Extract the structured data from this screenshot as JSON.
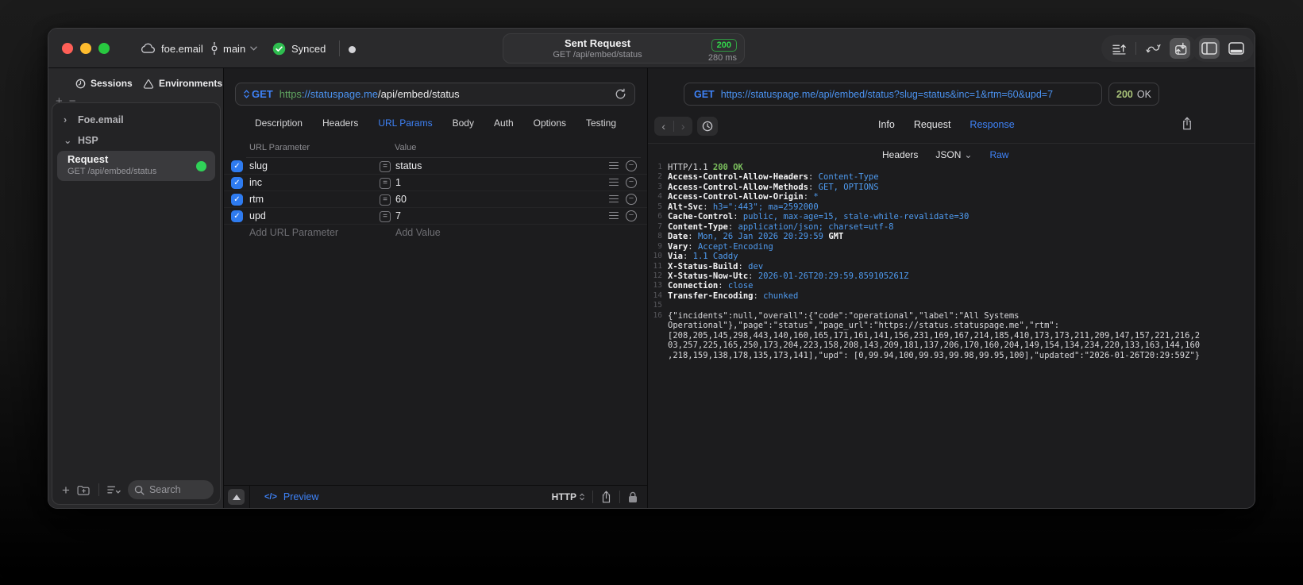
{
  "colors": {
    "accent_blue": "#3e82f7",
    "traffic_red": "#ff5f57",
    "traffic_yellow": "#febc2e",
    "traffic_green": "#28c840",
    "sync_green": "#2ebd4f",
    "badge_green": "#32d74b",
    "status_green": "#a9c379",
    "code_blue": "#4f9bf0",
    "code_green": "#7cc15e",
    "url_scheme_green": "#5fa360"
  },
  "titlebar": {
    "project": "foe.email",
    "branch": "main",
    "sync_status": "Synced",
    "request_summary": {
      "title": "Sent Request",
      "method_path": "GET /api/embed/status",
      "status_code": "200",
      "duration": "280 ms"
    },
    "icons": [
      "cloud-icon",
      "commit-icon",
      "chevron-down-icon",
      "sync-check-icon",
      "export-lines-icon",
      "flow-arrows-icon",
      "import-box-icon",
      "sidebar-left-icon",
      "panel-bottom-icon"
    ]
  },
  "sidebar": {
    "tabs": [
      {
        "label": "Sessions",
        "icon": "clock-icon"
      },
      {
        "label": "Environments",
        "icon": "environments-icon"
      }
    ],
    "add_label": "+",
    "remove_label": "−",
    "tree": [
      {
        "label": "Foe.email",
        "state": "collapsed",
        "chevron": "›"
      },
      {
        "label": "HSP",
        "state": "expanded",
        "chevron": "⌄"
      }
    ],
    "request_item": {
      "title": "Request",
      "subtitle": "GET /api/embed/status",
      "status_dot": "green"
    },
    "search_placeholder": "Search"
  },
  "request_editor": {
    "method": "GET",
    "url_scheme": "https",
    "url_host": "://statuspage.me",
    "url_path": "/api/embed/status",
    "tabs": [
      "Description",
      "Headers",
      "URL Params",
      "Body",
      "Auth",
      "Options",
      "Testing"
    ],
    "active_tab": "URL Params",
    "params_table": {
      "columns": [
        "URL Parameter",
        "Value"
      ],
      "rows": [
        {
          "enabled": true,
          "name": "slug",
          "operator": "=",
          "value": "status"
        },
        {
          "enabled": true,
          "name": "inc",
          "operator": "=",
          "value": "1"
        },
        {
          "enabled": true,
          "name": "rtm",
          "operator": "=",
          "value": "60"
        },
        {
          "enabled": true,
          "name": "upd",
          "operator": "=",
          "value": "7"
        }
      ],
      "add_name_placeholder": "Add URL Parameter",
      "add_value_placeholder": "Add Value"
    },
    "footer": {
      "preview_icon": "</>",
      "preview_label": "Preview",
      "protocol": "HTTP"
    }
  },
  "response_viewer": {
    "method": "GET",
    "url": "https://statuspage.me/api/embed/status?slug=status&inc=1&rtm=60&upd=7",
    "status_code": "200",
    "status_text": "OK",
    "tabs": [
      "Info",
      "Request",
      "Response"
    ],
    "active_tab": "Response",
    "subtabs": [
      "Headers",
      "JSON",
      "Raw"
    ],
    "active_subtab": "Raw",
    "body_lines": [
      {
        "n": "1",
        "seg": [
          {
            "t": "HTTP/1.1 ",
            "c": "p"
          },
          {
            "t": "200 OK",
            "c": "g"
          }
        ]
      },
      {
        "n": "2",
        "seg": [
          {
            "t": "Access-Control-Allow-Headers",
            "c": "w"
          },
          {
            "t": ": ",
            "c": "p"
          },
          {
            "t": "Content-Type",
            "c": "b"
          }
        ]
      },
      {
        "n": "3",
        "seg": [
          {
            "t": "Access-Control-Allow-Methods",
            "c": "w"
          },
          {
            "t": ": ",
            "c": "p"
          },
          {
            "t": "GET, OPTIONS",
            "c": "b"
          }
        ]
      },
      {
        "n": "4",
        "seg": [
          {
            "t": "Access-Control-Allow-Origin",
            "c": "w"
          },
          {
            "t": ": ",
            "c": "p"
          },
          {
            "t": "*",
            "c": "b"
          }
        ]
      },
      {
        "n": "5",
        "seg": [
          {
            "t": "Alt-Svc",
            "c": "w"
          },
          {
            "t": ": ",
            "c": "p"
          },
          {
            "t": "h3=\":443\"; ma=2592000",
            "c": "b"
          }
        ]
      },
      {
        "n": "6",
        "seg": [
          {
            "t": "Cache-Control",
            "c": "w"
          },
          {
            "t": ": ",
            "c": "p"
          },
          {
            "t": "public, max-age=15, stale-while-revalidate=30",
            "c": "b"
          }
        ]
      },
      {
        "n": "7",
        "seg": [
          {
            "t": "Content-Type",
            "c": "w"
          },
          {
            "t": ": ",
            "c": "p"
          },
          {
            "t": "application/json; charset=utf-8",
            "c": "b"
          }
        ]
      },
      {
        "n": "8",
        "seg": [
          {
            "t": "Date",
            "c": "w"
          },
          {
            "t": ": ",
            "c": "p"
          },
          {
            "t": "Mon, 26 Jan 2026 20:29:59 ",
            "c": "b"
          },
          {
            "t": "GMT",
            "c": "w"
          }
        ]
      },
      {
        "n": "9",
        "seg": [
          {
            "t": "Vary",
            "c": "w"
          },
          {
            "t": ": ",
            "c": "p"
          },
          {
            "t": "Accept-Encoding",
            "c": "b"
          }
        ]
      },
      {
        "n": "10",
        "seg": [
          {
            "t": "Via",
            "c": "w"
          },
          {
            "t": ": ",
            "c": "p"
          },
          {
            "t": "1.1 Caddy",
            "c": "b"
          }
        ]
      },
      {
        "n": "11",
        "seg": [
          {
            "t": "X-Status-Build",
            "c": "w"
          },
          {
            "t": ": ",
            "c": "p"
          },
          {
            "t": "dev",
            "c": "b"
          }
        ]
      },
      {
        "n": "12",
        "seg": [
          {
            "t": "X-Status-Now-Utc",
            "c": "w"
          },
          {
            "t": ": ",
            "c": "p"
          },
          {
            "t": "2026-01-26T20:29:59.859105261Z",
            "c": "b"
          }
        ]
      },
      {
        "n": "13",
        "seg": [
          {
            "t": "Connection",
            "c": "w"
          },
          {
            "t": ": ",
            "c": "p"
          },
          {
            "t": "close",
            "c": "b"
          }
        ]
      },
      {
        "n": "14",
        "seg": [
          {
            "t": "Transfer-Encoding",
            "c": "w"
          },
          {
            "t": ": ",
            "c": "p"
          },
          {
            "t": "chunked",
            "c": "b"
          }
        ]
      },
      {
        "n": "15",
        "seg": []
      },
      {
        "n": "16",
        "seg": [
          {
            "t": "{\"incidents\":null,\"overall\":{\"code\":\"operational\",\"label\":\"All Systems Operational\"},\"page\":\"status\",\"page_url\":\"https://status.statuspage.me\",\"rtm\": [208,205,145,298,443,140,160,165,171,161,141,156,231,169,167,214,185,410,173,173,211,209,147,157,221,216,203,257,225,165,250,173,204,223,158,208,143,209,181,137,206,170,160,204,149,154,134,234,220,133,163,144,160,218,159,138,178,135,173,141],\"upd\": [0,99.94,100,99.93,99.98,99.95,100],\"updated\":\"2026-01-26T20:29:59Z\"}",
            "c": "p"
          }
        ]
      }
    ]
  }
}
